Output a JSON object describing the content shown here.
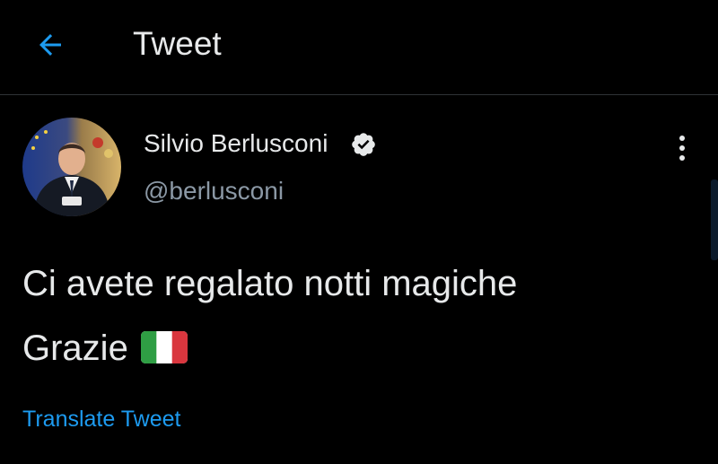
{
  "header": {
    "title": "Tweet",
    "back_icon": "arrow-left-icon"
  },
  "author": {
    "display_name": "Silvio Berlusconi",
    "handle": "@berlusconi",
    "verified": true,
    "verified_icon": "verified-badge-icon"
  },
  "tweet": {
    "line1": "Ci avete regalato notti magiche",
    "line2": "Grazie",
    "emoji": "flag-italy-icon"
  },
  "actions": {
    "translate_label": "Translate Tweet",
    "more_icon": "more-vertical-icon"
  },
  "colors": {
    "background": "#000000",
    "text_primary": "#e7e9ea",
    "text_secondary": "#8b98a5",
    "accent": "#1d9bf0",
    "divider": "#2f3336"
  }
}
